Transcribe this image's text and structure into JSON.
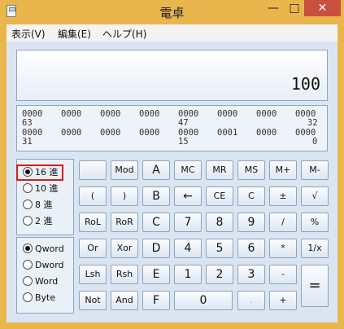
{
  "window": {
    "title": "電卓"
  },
  "titlebar_buttons": {
    "min": "—",
    "max": "□",
    "close": "✕"
  },
  "menu": [
    "表示(V)",
    "編集(E)",
    "ヘルプ(H)"
  ],
  "display": {
    "value": "100"
  },
  "bits": {
    "row1": [
      "0000",
      "0000",
      "0000",
      "0000",
      "0000",
      "0000",
      "0000",
      "0000"
    ],
    "row1_labels": [
      "63",
      "47",
      "32"
    ],
    "row2": [
      "0000",
      "0000",
      "0000",
      "0000",
      "0000",
      "0001",
      "0000",
      "0000"
    ],
    "row2_labels": [
      "31",
      "15",
      "0"
    ]
  },
  "radix": [
    {
      "label": "16 進",
      "checked": true
    },
    {
      "label": "10 進",
      "checked": false
    },
    {
      "label": "8 進",
      "checked": false
    },
    {
      "label": "2 進",
      "checked": false
    }
  ],
  "word_size": [
    {
      "label": "Qword",
      "checked": true
    },
    {
      "label": "Dword",
      "checked": false
    },
    {
      "label": "Word",
      "checked": false
    },
    {
      "label": "Byte",
      "checked": false
    }
  ],
  "keys": [
    {
      "label": "",
      "name": "blank-key"
    },
    {
      "label": "Mod",
      "name": "mod-key"
    },
    {
      "label": "A",
      "name": "key-a"
    },
    {
      "label": "MC",
      "name": "mc-key"
    },
    {
      "label": "MR",
      "name": "mr-key"
    },
    {
      "label": "MS",
      "name": "ms-key"
    },
    {
      "label": "M+",
      "name": "mplus-key"
    },
    {
      "label": "M-",
      "name": "mminus-key"
    },
    {
      "label": "(",
      "name": "open-paren-key"
    },
    {
      "label": ")",
      "name": "close-paren-key"
    },
    {
      "label": "B",
      "name": "key-b"
    },
    {
      "label": "←",
      "name": "backspace-key"
    },
    {
      "label": "CE",
      "name": "ce-key"
    },
    {
      "label": "C",
      "name": "c-key"
    },
    {
      "label": "±",
      "name": "plusminus-key"
    },
    {
      "label": "√",
      "name": "sqrt-key"
    },
    {
      "label": "RoL",
      "name": "rol-key"
    },
    {
      "label": "RoR",
      "name": "ror-key"
    },
    {
      "label": "C",
      "name": "key-hex-c"
    },
    {
      "label": "7",
      "name": "key-7"
    },
    {
      "label": "8",
      "name": "key-8"
    },
    {
      "label": "9",
      "name": "key-9"
    },
    {
      "label": "/",
      "name": "divide-key"
    },
    {
      "label": "%",
      "name": "percent-key"
    },
    {
      "label": "Or",
      "name": "or-key"
    },
    {
      "label": "Xor",
      "name": "xor-key"
    },
    {
      "label": "D",
      "name": "key-d"
    },
    {
      "label": "4",
      "name": "key-4"
    },
    {
      "label": "5",
      "name": "key-5"
    },
    {
      "label": "6",
      "name": "key-6"
    },
    {
      "label": "*",
      "name": "multiply-key"
    },
    {
      "label": "1/x",
      "name": "reciprocal-key"
    },
    {
      "label": "Lsh",
      "name": "lsh-key"
    },
    {
      "label": "Rsh",
      "name": "rsh-key"
    },
    {
      "label": "E",
      "name": "key-e"
    },
    {
      "label": "1",
      "name": "key-1"
    },
    {
      "label": "2",
      "name": "key-2"
    },
    {
      "label": "3",
      "name": "key-3"
    },
    {
      "label": "-",
      "name": "minus-key"
    },
    {
      "label": "Not",
      "name": "not-key"
    },
    {
      "label": "And",
      "name": "and-key"
    },
    {
      "label": "F",
      "name": "key-f"
    },
    {
      "label": "0",
      "name": "key-0"
    },
    {
      "label": ".",
      "name": "decimal-key"
    },
    {
      "label": "+",
      "name": "plus-key"
    },
    {
      "label": "=",
      "name": "equals-key"
    }
  ]
}
